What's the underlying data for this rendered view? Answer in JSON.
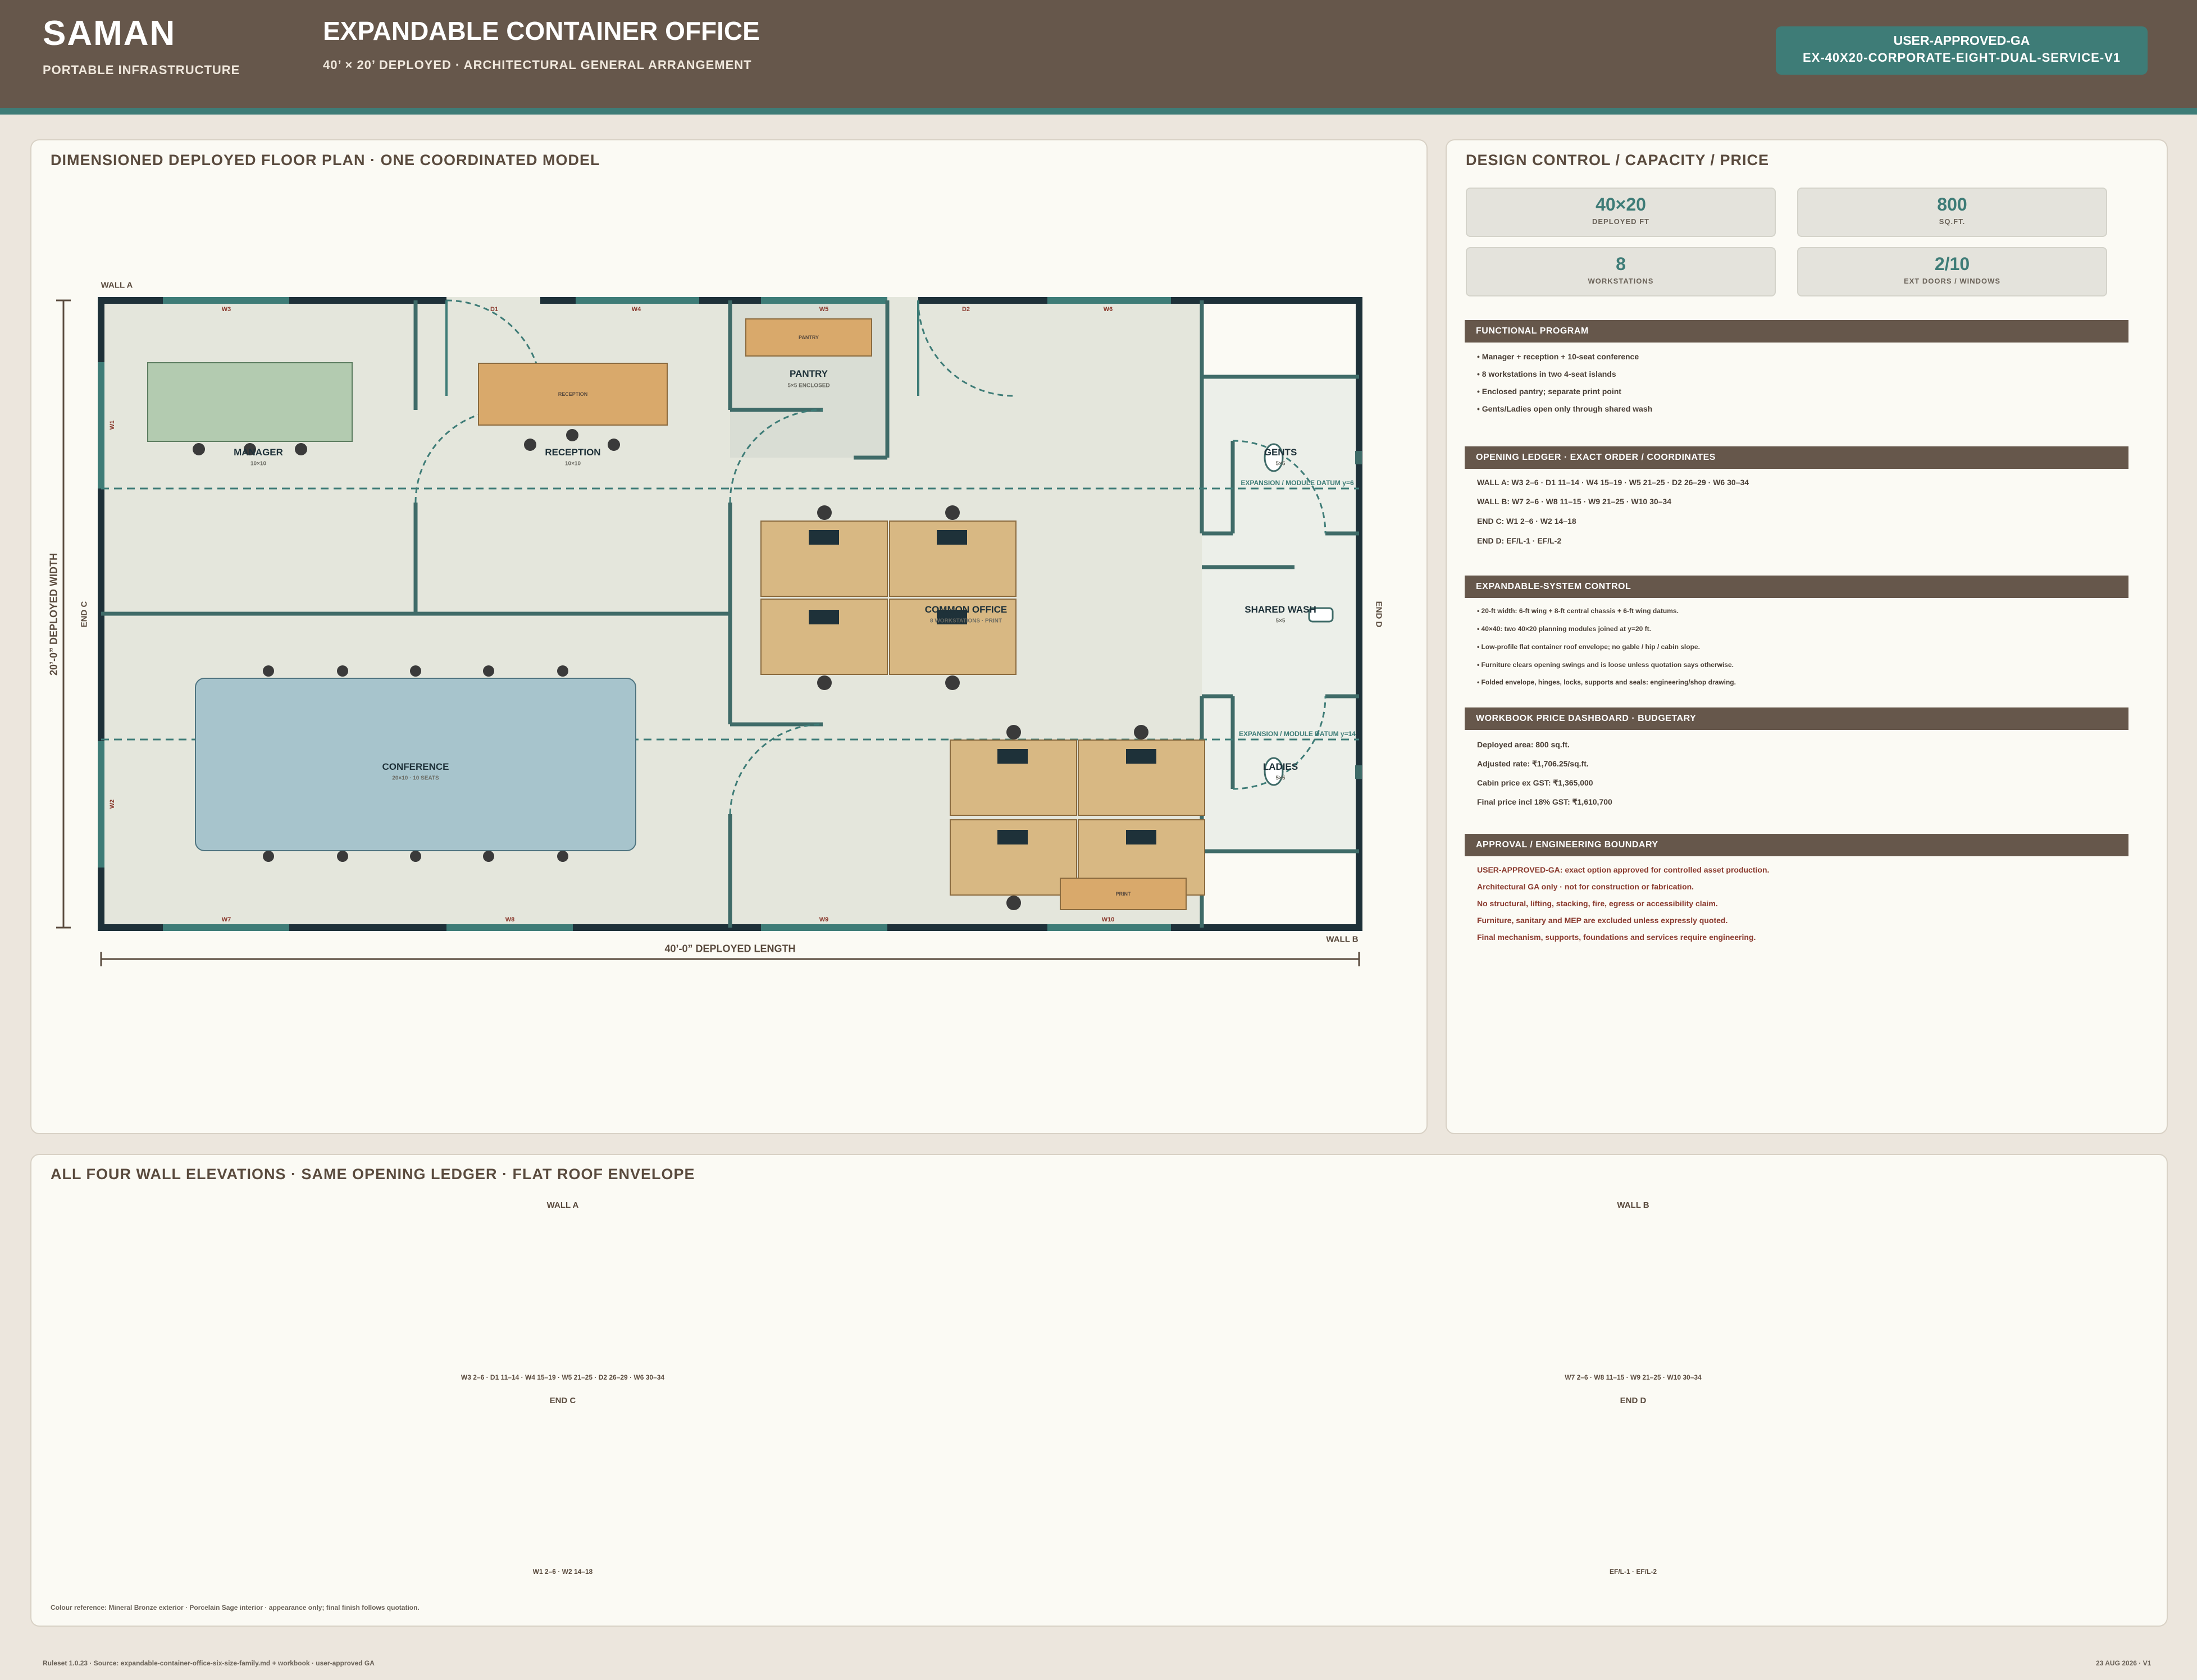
{
  "header": {
    "brand": "SAMAN",
    "brand_sub": "PORTABLE INFRASTRUCTURE",
    "title": "EXPANDABLE CONTAINER OFFICE",
    "subtitle": "40’ × 20’ DEPLOYED · ARCHITECTURAL GENERAL ARRANGEMENT",
    "badge_status": "USER-APPROVED-GA",
    "badge_code": "EX-40X20-CORPORATE-EIGHT-DUAL-SERVICE-V1"
  },
  "plan": {
    "title": "DIMENSIONED DEPLOYED FLOOR PLAN · ONE COORDINATED MODEL",
    "wall_a": "WALL A",
    "wall_b": "WALL B",
    "end_c": "END C",
    "end_d": "END D",
    "length_dim": "40’-0” DEPLOYED LENGTH",
    "width_dim": "20’-0” DEPLOYED WIDTH",
    "datum_1": "EXPANSION / MODULE DATUM y=6",
    "datum_2": "EXPANSION / MODULE DATUM y=14",
    "rooms": {
      "manager": "MANAGER",
      "manager_sz": "10×10",
      "reception": "RECEPTION",
      "reception_sz": "10×10",
      "reception_desk": "RECEPTION",
      "pantry": "PANTRY",
      "pantry_sz": "5×5 ENCLOSED",
      "pantry_counter": "PANTRY",
      "common": "COMMON OFFICE",
      "common_sz": "8 WORKSTATIONS · PRINT",
      "gents": "GENTS",
      "gents_sz": "5×5",
      "wash": "SHARED WASH",
      "wash_sz": "5×5",
      "ladies": "LADIES",
      "ladies_sz": "5×5",
      "conference": "CONFERENCE",
      "conference_sz": "20×10 · 10 SEATS",
      "print": "PRINT"
    },
    "openings": {
      "w3": "W3",
      "d1": "D1",
      "w4": "W4",
      "w5": "W5",
      "d2": "D2",
      "w6": "W6",
      "w7": "W7",
      "w8": "W8",
      "w9": "W9",
      "w10": "W10",
      "w1": "W1",
      "w2": "W2"
    }
  },
  "control": {
    "title": "DESIGN CONTROL / CAPACITY / PRICE",
    "stats": [
      {
        "value": "40×20",
        "label": "DEPLOYED FT"
      },
      {
        "value": "800",
        "label": "SQ.FT."
      },
      {
        "value": "8",
        "label": "WORKSTATIONS"
      },
      {
        "value": "2/10",
        "label": "EXT DOORS / WINDOWS"
      }
    ],
    "sections": {
      "functional": {
        "title": "FUNCTIONAL PROGRAM",
        "items": [
          "• Manager + reception + 10-seat conference",
          "• 8 workstations in two 4-seat islands",
          "• Enclosed pantry; separate print point",
          "• Gents/Ladies open only through shared wash"
        ]
      },
      "ledger": {
        "title": "OPENING LEDGER · EXACT ORDER / COORDINATES",
        "items": [
          "WALL A: W3 2–6 · D1 11–14 · W4 15–19 · W5 21–25 · D2 26–29 · W6 30–34",
          "WALL B: W7 2–6 · W8 11–15 · W9 21–25 · W10 30–34",
          "END C: W1 2–6 · W2 14–18",
          "END D: EF/L-1 · EF/L-2"
        ]
      },
      "system": {
        "title": "EXPANDABLE-SYSTEM CONTROL",
        "items": [
          "• 20-ft width: 6-ft wing + 8-ft central chassis + 6-ft wing datums.",
          "• 40×40: two 40×20 planning modules joined at y=20 ft.",
          "• Low-profile flat container roof envelope; no gable / hip / cabin slope.",
          "• Furniture clears opening swings and is loose unless quotation says otherwise.",
          "• Folded envelope, hinges, locks, supports and seals: engineering/shop drawing."
        ]
      },
      "price": {
        "title": "WORKBOOK PRICE DASHBOARD · BUDGETARY",
        "items": [
          "Deployed area: 800 sq.ft.",
          "Adjusted rate: ₹1,706.25/sq.ft.",
          "Cabin price ex GST: ₹1,365,000",
          "Final price incl 18% GST: ₹1,610,700"
        ]
      },
      "approval": {
        "title": "APPROVAL / ENGINEERING BOUNDARY",
        "items": [
          "USER-APPROVED-GA: exact option approved for controlled asset production.",
          "Architectural GA only · not for construction or fabrication.",
          "No structural, lifting, stacking, fire, egress or accessibility claim.",
          "Furniture, sanitary and MEP are excluded unless expressly quoted.",
          "Final mechanism, supports, foundations and services require engineering."
        ]
      }
    }
  },
  "elevations": {
    "title": "ALL FOUR WALL ELEVATIONS · SAME OPENING LEDGER · FLAT ROOF ENVELOPE",
    "wall_a": {
      "label": "WALL A",
      "caption": "W3 2–6 · D1 11–14 · W4 15–19 · W5 21–25 · D2 26–29 · W6 30–34"
    },
    "wall_b": {
      "label": "WALL B",
      "caption": "W7 2–6 · W8 11–15 · W9 21–25 · W10 30–34"
    },
    "end_c": {
      "label": "END C",
      "caption": "W1 2–6 · W2 14–18"
    },
    "end_d": {
      "label": "END D",
      "caption": "EF/L-1 · EF/L-2"
    },
    "colour_note": "Colour reference: Mineral Bronze exterior · Porcelain Sage interior · appearance only; final finish follows quotation."
  },
  "footer": {
    "left": "Ruleset 1.0.23 · Source: expandable-container-office-six-size-family.md + workbook · user-approved GA",
    "right": "23 AUG 2026 · V1"
  },
  "colors": {
    "header": "#66574b",
    "accent": "#3e7c77",
    "wall": "#1e3139",
    "floor": "#e4e6dc",
    "desk": "#d8b883",
    "conference_table": "#a7c4cc",
    "manager_table": "#b3cbb0",
    "reception_desk": "#d9a96b",
    "window": "#5fa3ae",
    "cladding": "#66574b",
    "warn": "#8a3a2e"
  }
}
